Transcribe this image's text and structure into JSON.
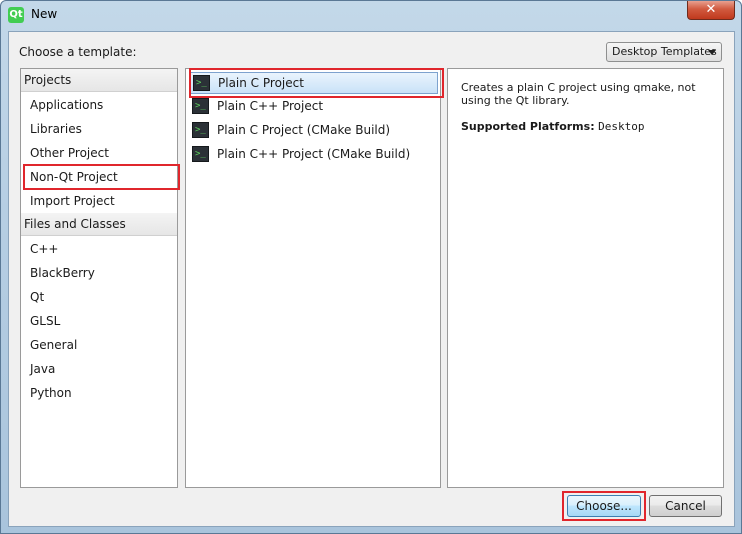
{
  "window": {
    "title": "New",
    "app_icon_text": "Qt",
    "close_glyph": "✕"
  },
  "header": {
    "choose_label": "Choose a template:",
    "filter_combo_value": "Desktop Templates"
  },
  "categories": {
    "projects_header": "Projects",
    "projects": [
      "Applications",
      "Libraries",
      "Other Project",
      "Non-Qt Project",
      "Import Project"
    ],
    "files_header": "Files and Classes",
    "files": [
      "C++",
      "BlackBerry",
      "Qt",
      "GLSL",
      "General",
      "Java",
      "Python"
    ],
    "selected": "Non-Qt Project"
  },
  "templates": {
    "items": [
      {
        "label": "Plain C Project",
        "icon": "terminal-icon"
      },
      {
        "label": "Plain C++ Project",
        "icon": "terminal-icon"
      },
      {
        "label": "Plain C Project (CMake Build)",
        "icon": "terminal-icon"
      },
      {
        "label": "Plain C++ Project (CMake Build)",
        "icon": "terminal-icon"
      }
    ],
    "selected": "Plain C Project",
    "icon_glyph": ">_"
  },
  "details": {
    "description": "Creates a plain C project using qmake, not using the Qt library.",
    "platforms_label": "Supported Platforms:",
    "platforms_value": "Desktop"
  },
  "buttons": {
    "choose": "Choose...",
    "cancel": "Cancel"
  },
  "colors": {
    "highlight": "#e0262c",
    "selection": "#c9e2f8"
  }
}
